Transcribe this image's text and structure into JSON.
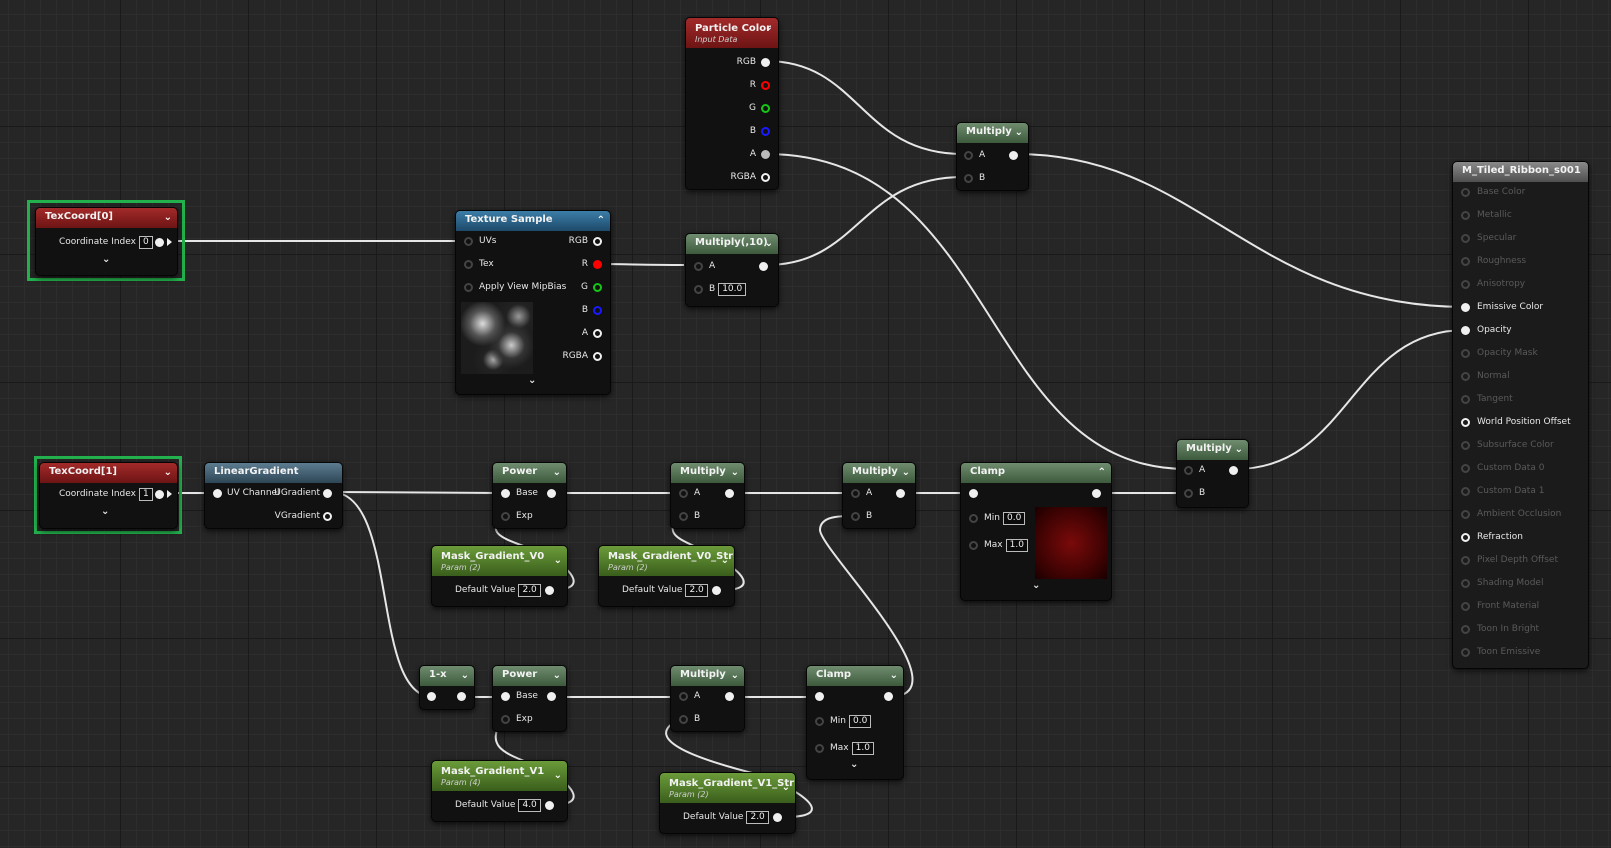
{
  "colors": {
    "wire": "#e8e8e8",
    "selection": "#22b14c",
    "r": "#ff0000",
    "g": "#14c814",
    "b": "#1a1aff"
  },
  "nodes": {
    "particle_color": {
      "title": "Particle Color",
      "subtitle": "Input Data",
      "pins": [
        "RGB",
        "R",
        "G",
        "B",
        "A",
        "RGBA"
      ]
    },
    "texcoord0": {
      "title": "TexCoord[0]",
      "label": "Coordinate Index",
      "value": "0"
    },
    "texcoord1": {
      "title": "TexCoord[1]",
      "label": "Coordinate Index",
      "value": "1"
    },
    "texture_sample": {
      "title": "Texture Sample",
      "inputs": [
        "UVs",
        "Tex",
        "Apply View MipBias"
      ],
      "outputs": [
        "RGB",
        "R",
        "G",
        "B",
        "A",
        "RGBA"
      ]
    },
    "multiply10": {
      "title": "Multiply(,10)",
      "a": "A",
      "b": "B",
      "b_value": "10.0"
    },
    "multiply_top": {
      "title": "Multiply",
      "a": "A",
      "b": "B"
    },
    "multiply_right": {
      "title": "Multiply",
      "a": "A",
      "b": "B"
    },
    "linear_gradient": {
      "title": "LinearGradient",
      "input": "UV Channel",
      "out1": "UGradient",
      "out2": "VGradient"
    },
    "power1": {
      "title": "Power",
      "base": "Base",
      "exp": "Exp"
    },
    "power2": {
      "title": "Power",
      "base": "Base",
      "exp": "Exp"
    },
    "multiply_a": {
      "title": "Multiply",
      "a": "A",
      "b": "B"
    },
    "multiply_b": {
      "title": "Multiply",
      "a": "A",
      "b": "B"
    },
    "multiply_c": {
      "title": "Multiply",
      "a": "A",
      "b": "B"
    },
    "one_minus": {
      "title": "1-x"
    },
    "clamp1": {
      "title": "Clamp",
      "min": "Min",
      "max": "Max",
      "min_value": "0.0",
      "max_value": "1.0"
    },
    "clamp2": {
      "title": "Clamp",
      "min": "Min",
      "max": "Max",
      "min_value": "0.0",
      "max_value": "1.0"
    },
    "mask_v0": {
      "title": "Mask_Gradient_V0",
      "subtitle": "Param (2)",
      "label": "Default Value",
      "value": "2.0"
    },
    "mask_v0_str": {
      "title": "Mask_Gradient_V0_Str",
      "subtitle": "Param (2)",
      "label": "Default Value",
      "value": "2.0"
    },
    "mask_v1": {
      "title": "Mask_Gradient_V1",
      "subtitle": "Param (4)",
      "label": "Default Value",
      "value": "4.0"
    },
    "mask_v1_str": {
      "title": "Mask_Gradient_V1_Str",
      "subtitle": "Param (2)",
      "label": "Default Value",
      "value": "2.0"
    }
  },
  "material": {
    "title": "M_Tiled_Ribbon_s001",
    "pins": [
      {
        "label": "Base Color",
        "active": false
      },
      {
        "label": "Metallic",
        "active": false
      },
      {
        "label": "Specular",
        "active": false
      },
      {
        "label": "Roughness",
        "active": false
      },
      {
        "label": "Anisotropy",
        "active": false
      },
      {
        "label": "Emissive Color",
        "active": true
      },
      {
        "label": "Opacity",
        "active": true
      },
      {
        "label": "Opacity Mask",
        "active": false
      },
      {
        "label": "Normal",
        "active": false
      },
      {
        "label": "Tangent",
        "active": false
      },
      {
        "label": "World Position Offset",
        "active": true
      },
      {
        "label": "Subsurface Color",
        "active": false
      },
      {
        "label": "Custom Data 0",
        "active": false
      },
      {
        "label": "Custom Data 1",
        "active": false
      },
      {
        "label": "Ambient Occlusion",
        "active": false
      },
      {
        "label": "Refraction",
        "active": true
      },
      {
        "label": "Pixel Depth Offset",
        "active": false
      },
      {
        "label": "Shading Model",
        "active": false
      },
      {
        "label": "Front Material",
        "active": false
      },
      {
        "label": "Toon In Bright",
        "active": false
      },
      {
        "label": "Toon Emissive",
        "active": false
      }
    ]
  }
}
